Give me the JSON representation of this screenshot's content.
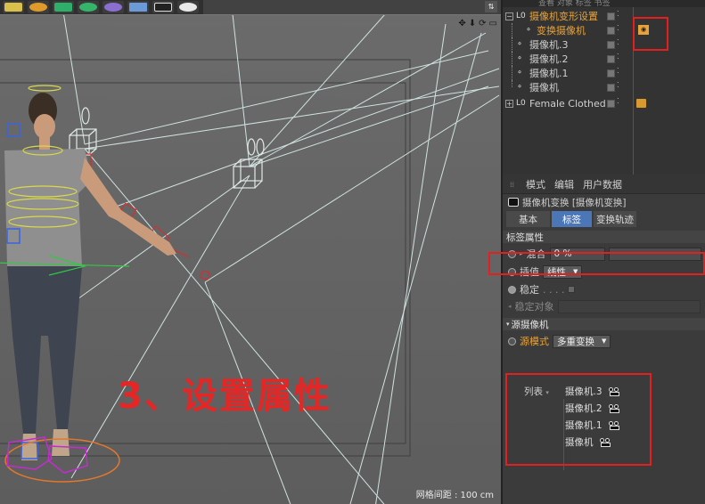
{
  "toolbar": {
    "icons": [
      "cube-icon",
      "bend-icon",
      "array-icon",
      "cloner-icon",
      "deformer-icon",
      "floor-icon",
      "camera-icon",
      "light-icon"
    ]
  },
  "viewport": {
    "nav_icons": [
      "move-view-icon",
      "dolly-icon",
      "rotate-view-icon",
      "maximize-icon"
    ],
    "grid_status": "网格间距 : 100 cm",
    "annotation": "3、设置属性"
  },
  "object_manager": {
    "menu_fragments": "查看  对象  标签  书签",
    "rows": [
      {
        "label": "摄像机变形设置",
        "color": "#e8a23a"
      },
      {
        "label": "变换摄像机",
        "color": "#e8a23a"
      },
      {
        "label": "摄像机.3",
        "color": "#cfcfcf"
      },
      {
        "label": "摄像机.2",
        "color": "#cfcfcf"
      },
      {
        "label": "摄像机.1",
        "color": "#cfcfcf"
      },
      {
        "label": "摄像机",
        "color": "#cfcfcf"
      },
      {
        "label": "Female Clothed",
        "color": "#cfcfcf"
      }
    ]
  },
  "attribute_manager": {
    "menu": [
      "模式",
      "编辑",
      "用户数据"
    ],
    "title": "摄像机变换 [摄像机变换]",
    "tabs": [
      "基本",
      "标签",
      "变换轨迹"
    ],
    "active_tab": "标签",
    "tag_section": "标签属性",
    "blend_label": "混合",
    "blend_value": "0 %",
    "interp_label": "插值",
    "interp_value": "线性",
    "stable_label": "稳定",
    "stable_dots": ". . . .",
    "stable_obj_label": "稳定对象",
    "source_section": "源摄像机",
    "source_mode_label": "源模式",
    "source_mode_value": "多重变换",
    "list_label": "列表",
    "list_items": [
      "摄像机.3",
      "摄像机.2",
      "摄像机.1",
      "摄像机"
    ]
  },
  "colors": {
    "accent_orange": "#e8a23a",
    "tab_active": "#4b76b8",
    "annotation_red": "#e62525"
  }
}
